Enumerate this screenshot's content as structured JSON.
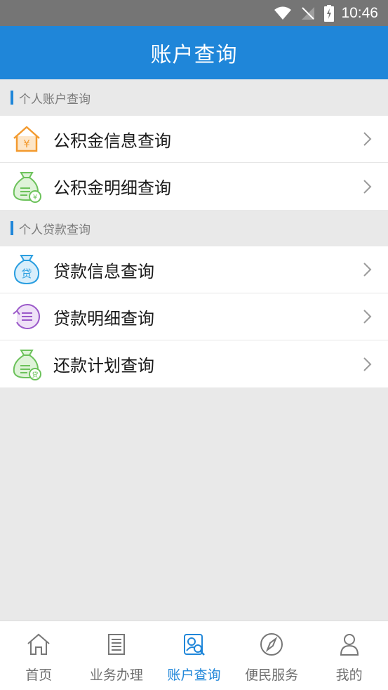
{
  "status_bar": {
    "time": "10:46"
  },
  "app_bar": {
    "title": "账户查询"
  },
  "sections": [
    {
      "label": "个人账户查询",
      "items": [
        {
          "label": "公积金信息查询",
          "icon": "house-yen-icon"
        },
        {
          "label": "公积金明细查询",
          "icon": "money-bag-yen-icon"
        }
      ]
    },
    {
      "label": "个人贷款查询",
      "items": [
        {
          "label": "贷款信息查询",
          "icon": "loan-bag-icon"
        },
        {
          "label": "贷款明细查询",
          "icon": "loan-detail-list-icon"
        },
        {
          "label": "还款计划查询",
          "icon": "repayment-bag-icon"
        }
      ]
    }
  ],
  "tabs": [
    {
      "label": "首页",
      "icon": "home-icon"
    },
    {
      "label": "业务办理",
      "icon": "document-icon"
    },
    {
      "label": "账户查询",
      "icon": "account-search-icon",
      "active": true
    },
    {
      "label": "便民服务",
      "icon": "compass-icon"
    },
    {
      "label": "我的",
      "icon": "user-icon"
    }
  ],
  "colors": {
    "primary": "#1f86d9",
    "status_bar": "#757575",
    "background": "#e9e9e9",
    "orange_icon": "#f39a2e",
    "green_icon": "#6cc25b",
    "blue_icon": "#2a9ee0",
    "purple_icon": "#9b59c9"
  }
}
